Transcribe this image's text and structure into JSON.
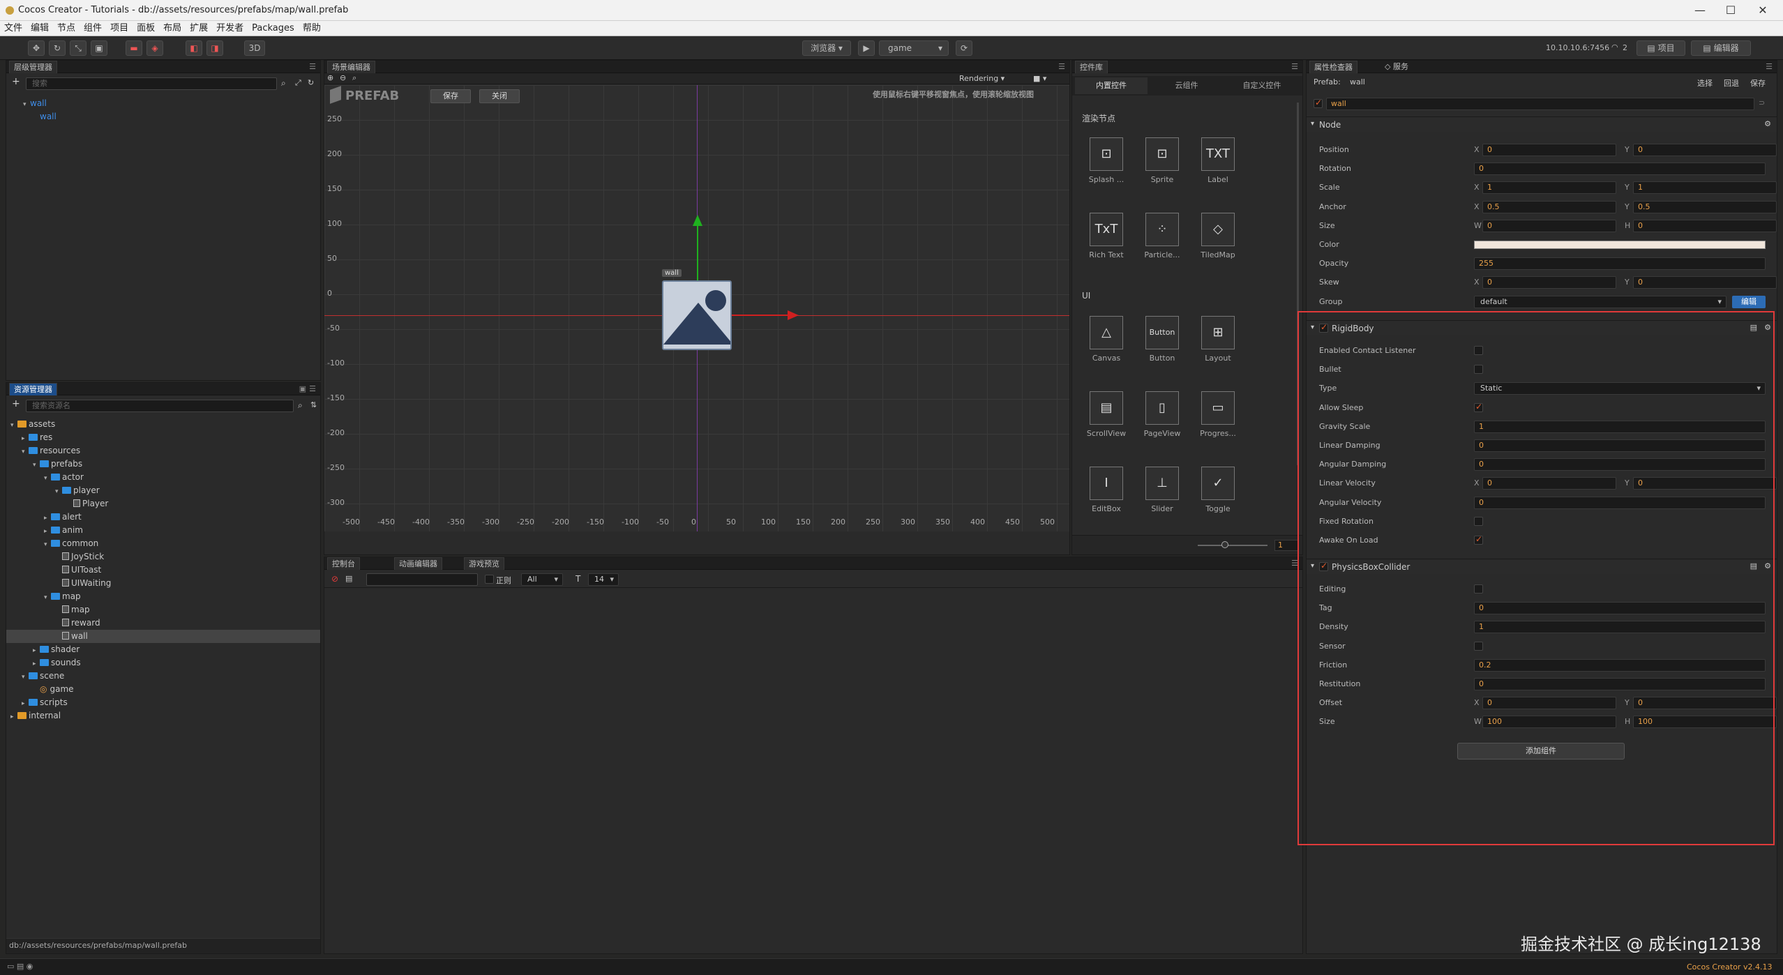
{
  "window": {
    "title": "Cocos Creator - Tutorials - db://assets/resources/prefabs/map/wall.prefab",
    "min": "—",
    "max": "☐",
    "close": "✕"
  },
  "menu": [
    "文件",
    "编辑",
    "节点",
    "组件",
    "项目",
    "面板",
    "布局",
    "扩展",
    "开发者",
    "Packages",
    "帮助"
  ],
  "toolbar": {
    "mode_3d": "3D",
    "preview_select": "浏览器",
    "play": "▶",
    "scene_select": "game",
    "refresh": "⟳",
    "ip": "10.10.10.6:7456",
    "wifi_count": "2",
    "project_btn": "项目",
    "editor_btn": "编辑器"
  },
  "hierarchy": {
    "tab": "层级管理器",
    "search_placeholder": "搜索",
    "nodes": [
      {
        "label": "wall",
        "indent": 0
      },
      {
        "label": "wall",
        "indent": 1
      }
    ]
  },
  "assets": {
    "tab": "资源管理器",
    "search_placeholder": "搜索资源名",
    "path": "db://assets/resources/prefabs/map/wall.prefab",
    "items": [
      {
        "label": "assets",
        "depth": 0,
        "type": "root",
        "arrow": "▾"
      },
      {
        "label": "res",
        "depth": 1,
        "type": "folder",
        "arrow": "▸"
      },
      {
        "label": "resources",
        "depth": 1,
        "type": "folder",
        "arrow": "▾"
      },
      {
        "label": "prefabs",
        "depth": 2,
        "type": "folder",
        "arrow": "▾"
      },
      {
        "label": "actor",
        "depth": 3,
        "type": "folder",
        "arrow": "▾"
      },
      {
        "label": "player",
        "depth": 4,
        "type": "folder",
        "arrow": "▾"
      },
      {
        "label": "Player",
        "depth": 5,
        "type": "file",
        "arrow": ""
      },
      {
        "label": "alert",
        "depth": 3,
        "type": "folder",
        "arrow": "▸"
      },
      {
        "label": "anim",
        "depth": 3,
        "type": "folder",
        "arrow": "▸"
      },
      {
        "label": "common",
        "depth": 3,
        "type": "folder",
        "arrow": "▾"
      },
      {
        "label": "JoyStick",
        "depth": 4,
        "type": "file",
        "arrow": ""
      },
      {
        "label": "UIToast",
        "depth": 4,
        "type": "file",
        "arrow": ""
      },
      {
        "label": "UIWaiting",
        "depth": 4,
        "type": "file",
        "arrow": ""
      },
      {
        "label": "map",
        "depth": 3,
        "type": "folder",
        "arrow": "▾"
      },
      {
        "label": "map",
        "depth": 4,
        "type": "file",
        "arrow": ""
      },
      {
        "label": "reward",
        "depth": 4,
        "type": "file",
        "arrow": ""
      },
      {
        "label": "wall",
        "depth": 4,
        "type": "file",
        "arrow": "",
        "selected": true
      },
      {
        "label": "shader",
        "depth": 2,
        "type": "folder",
        "arrow": "▸"
      },
      {
        "label": "sounds",
        "depth": 2,
        "type": "folder",
        "arrow": "▸"
      },
      {
        "label": "scene",
        "depth": 1,
        "type": "folder",
        "arrow": "▾"
      },
      {
        "label": "game",
        "depth": 2,
        "type": "scene",
        "arrow": ""
      },
      {
        "label": "scripts",
        "depth": 1,
        "type": "folder",
        "arrow": "▸"
      },
      {
        "label": "internal",
        "depth": 0,
        "type": "root",
        "arrow": "▸"
      }
    ]
  },
  "scene": {
    "tab": "场景编辑器",
    "prefab_label": "PREFAB",
    "save": "保存",
    "close": "关闭",
    "rendering": "Rendering",
    "hint": "使用鼠标右键平移视窗焦点，使用滚轮缩放视图",
    "node_label": "wall",
    "y_ticks": [
      "250",
      "200",
      "150",
      "100",
      "50",
      "0",
      "-50",
      "-100",
      "-150",
      "-200",
      "-250",
      "-300"
    ],
    "x_ticks": [
      "-500",
      "-450",
      "-400",
      "-350",
      "-300",
      "-250",
      "-200",
      "-150",
      "-100",
      "-50",
      "0",
      "50",
      "100",
      "150",
      "200",
      "250",
      "300",
      "350",
      "400",
      "450",
      "500"
    ]
  },
  "widgets": {
    "tab": "控件库",
    "tabs": [
      "内置控件",
      "云组件",
      "自定义控件"
    ],
    "section_render": "渲染节点",
    "section_ui": "UI",
    "render": [
      {
        "label": "Splash ...",
        "icon": "⊡"
      },
      {
        "label": "Sprite",
        "icon": "⊡"
      },
      {
        "label": "Label",
        "icon": "TXT"
      },
      {
        "label": "Rich Text",
        "icon": "TxT"
      },
      {
        "label": "Particle...",
        "icon": "⁘"
      },
      {
        "label": "TiledMap",
        "icon": "◇"
      }
    ],
    "ui": [
      {
        "label": "Canvas",
        "icon": "△"
      },
      {
        "label": "Button",
        "icon": "Button"
      },
      {
        "label": "Layout",
        "icon": "⊞"
      },
      {
        "label": "ScrollView",
        "icon": "▤"
      },
      {
        "label": "PageView",
        "icon": "▯"
      },
      {
        "label": "Progres...",
        "icon": "▭"
      },
      {
        "label": "EditBox",
        "icon": "I"
      },
      {
        "label": "Slider",
        "icon": "⊥"
      },
      {
        "label": "Toggle",
        "icon": "✓"
      }
    ],
    "zoom_value": "1"
  },
  "console": {
    "tabs": [
      "控制台",
      "动画编辑器",
      "游戏预览"
    ],
    "regex": "正则",
    "filter": "All",
    "font_size": "14"
  },
  "inspector": {
    "tabs": [
      "属性检查器",
      "服务"
    ],
    "prefab_label": "Prefab:",
    "prefab_name": "wall",
    "select": "选择",
    "revert": "回退",
    "save": "保存",
    "node_name": "wall",
    "node_section": "Node",
    "node_props": [
      {
        "label": "Position",
        "axes": [
          "X",
          "Y"
        ],
        "values": [
          "0",
          "0"
        ]
      },
      {
        "label": "Rotation",
        "axes": [],
        "values": [
          "0"
        ]
      },
      {
        "label": "Scale",
        "axes": [
          "X",
          "Y"
        ],
        "values": [
          "1",
          "1"
        ]
      },
      {
        "label": "Anchor",
        "axes": [
          "X",
          "Y"
        ],
        "values": [
          "0.5",
          "0.5"
        ]
      },
      {
        "label": "Size",
        "axes": [
          "W",
          "H"
        ],
        "values": [
          "0",
          "0"
        ]
      },
      {
        "label": "Color",
        "axes": [],
        "values": [
          "#ffffff"
        ],
        "color": true
      },
      {
        "label": "Opacity",
        "axes": [],
        "values": [
          "255"
        ]
      },
      {
        "label": "Skew",
        "axes": [
          "X",
          "Y"
        ],
        "values": [
          "0",
          "0"
        ]
      },
      {
        "label": "Group",
        "axes": [],
        "values": [
          "default"
        ],
        "dropdown": true,
        "button": "编辑"
      }
    ],
    "rigid_section": "RigidBody",
    "rigid_props": [
      {
        "label": "Enabled Contact Listener",
        "check": false
      },
      {
        "label": "Bullet",
        "check": false
      },
      {
        "label": "Type",
        "dropdown": "Static"
      },
      {
        "label": "Allow Sleep",
        "check": true
      },
      {
        "label": "Gravity Scale",
        "values": [
          "1"
        ]
      },
      {
        "label": "Linear Damping",
        "values": [
          "0"
        ]
      },
      {
        "label": "Angular Damping",
        "values": [
          "0"
        ]
      },
      {
        "label": "Linear Velocity",
        "axes": [
          "X",
          "Y"
        ],
        "values": [
          "0",
          "0"
        ]
      },
      {
        "label": "Angular Velocity",
        "values": [
          "0"
        ]
      },
      {
        "label": "Fixed Rotation",
        "check": false
      },
      {
        "label": "Awake On Load",
        "check": true
      }
    ],
    "collider_section": "PhysicsBoxCollider",
    "collider_props": [
      {
        "label": "Editing",
        "check": false
      },
      {
        "label": "Tag",
        "values": [
          "0"
        ]
      },
      {
        "label": "Density",
        "values": [
          "1"
        ]
      },
      {
        "label": "Sensor",
        "check": false
      },
      {
        "label": "Friction",
        "values": [
          "0.2"
        ]
      },
      {
        "label": "Restitution",
        "values": [
          "0"
        ]
      },
      {
        "label": "Offset",
        "axes": [
          "X",
          "Y"
        ],
        "values": [
          "0",
          "0"
        ]
      },
      {
        "label": "Size",
        "axes": [
          "W",
          "H"
        ],
        "values": [
          "100",
          "100"
        ]
      }
    ],
    "add_component": "添加组件"
  },
  "watermark": "掘金技术社区 @ 成长ing12138",
  "version": "Cocos Creator v2.4.13",
  "colors": {
    "highlight": "#e03a3a",
    "accent": "#e8a049",
    "selected_tab": "#1c4d8a"
  }
}
